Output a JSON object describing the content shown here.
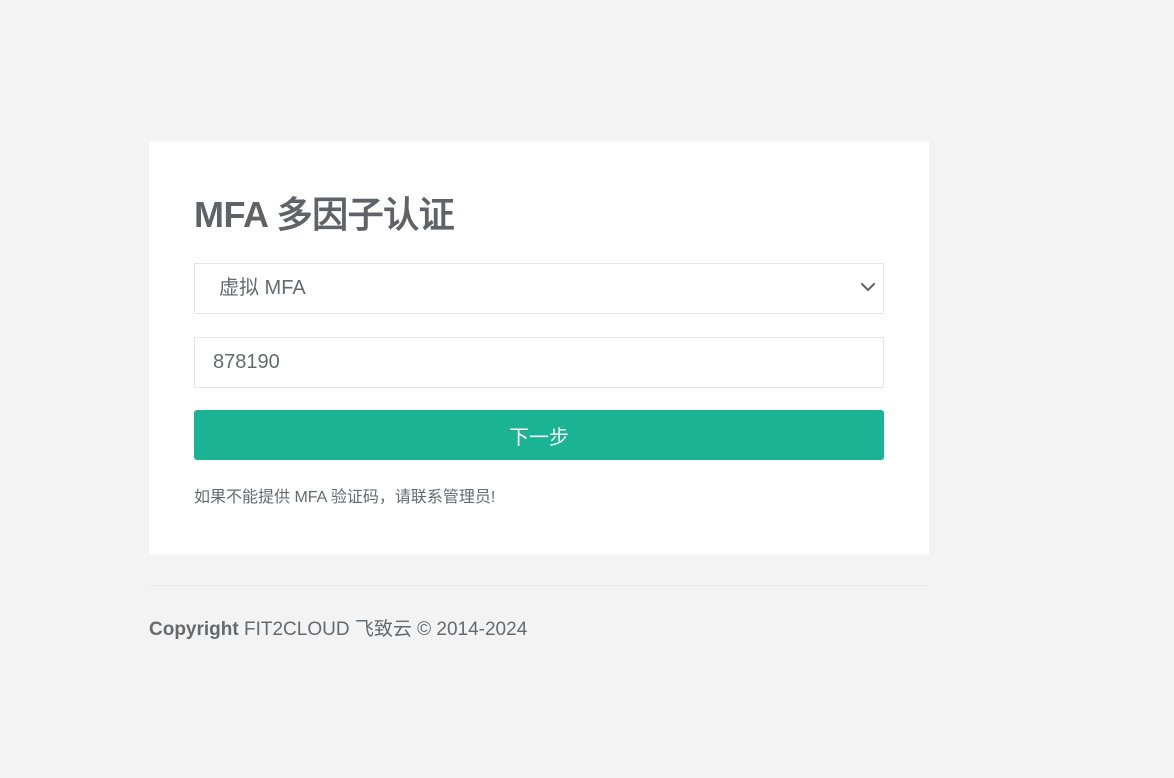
{
  "mfa": {
    "title": "MFA 多因子认证",
    "method_select": {
      "selected": "虚拟 MFA",
      "chevron_icon": "chevron-down-icon"
    },
    "code_input": {
      "value": "878190"
    },
    "next_button_label": "下一步",
    "help_text": "如果不能提供 MFA 验证码，请联系管理员!"
  },
  "footer": {
    "copyright_label": "Copyright",
    "copyright_text": " FIT2CLOUD 飞致云 © 2014-2024"
  },
  "colors": {
    "background": "#f3f3f4",
    "card": "#ffffff",
    "primary": "#1ab394",
    "text": "#676a6c"
  }
}
